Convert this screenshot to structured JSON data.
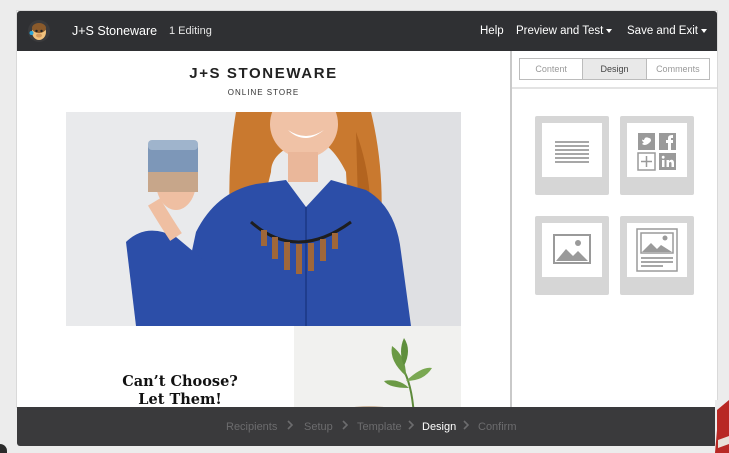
{
  "topbar": {
    "campaign_name": "J+S Stoneware",
    "editing_label": "1 Editing",
    "help_label": "Help",
    "preview_label": "Preview and Test",
    "save_label": "Save and Exit",
    "logo_icon": "mailchimp-logo-icon"
  },
  "email": {
    "brand_name": "J+S STONEWARE",
    "brand_sub": "ONLINE STORE",
    "callout_title_line1": "Can’t Choose?",
    "callout_title_line2": "Let Them!"
  },
  "panel": {
    "tabs": [
      {
        "label": "Content",
        "active": false
      },
      {
        "label": "Design",
        "active": true
      },
      {
        "label": "Comments",
        "active": false
      }
    ],
    "blocks": [
      {
        "icon": "text-block-icon"
      },
      {
        "icon": "social-share-block-icon"
      },
      {
        "icon": "image-block-icon"
      },
      {
        "icon": "image-card-block-icon"
      }
    ]
  },
  "steps": [
    {
      "label": "Recipients",
      "active": false
    },
    {
      "label": "Setup",
      "active": false
    },
    {
      "label": "Template",
      "active": false
    },
    {
      "label": "Design",
      "active": true
    },
    {
      "label": "Confirm",
      "active": false
    }
  ],
  "colors": {
    "topbar_bg": "#2f3033",
    "steps_bg": "#3a3a3c",
    "hero_shirt": "#2c4ea8",
    "hero_hair": "#c9792f"
  }
}
